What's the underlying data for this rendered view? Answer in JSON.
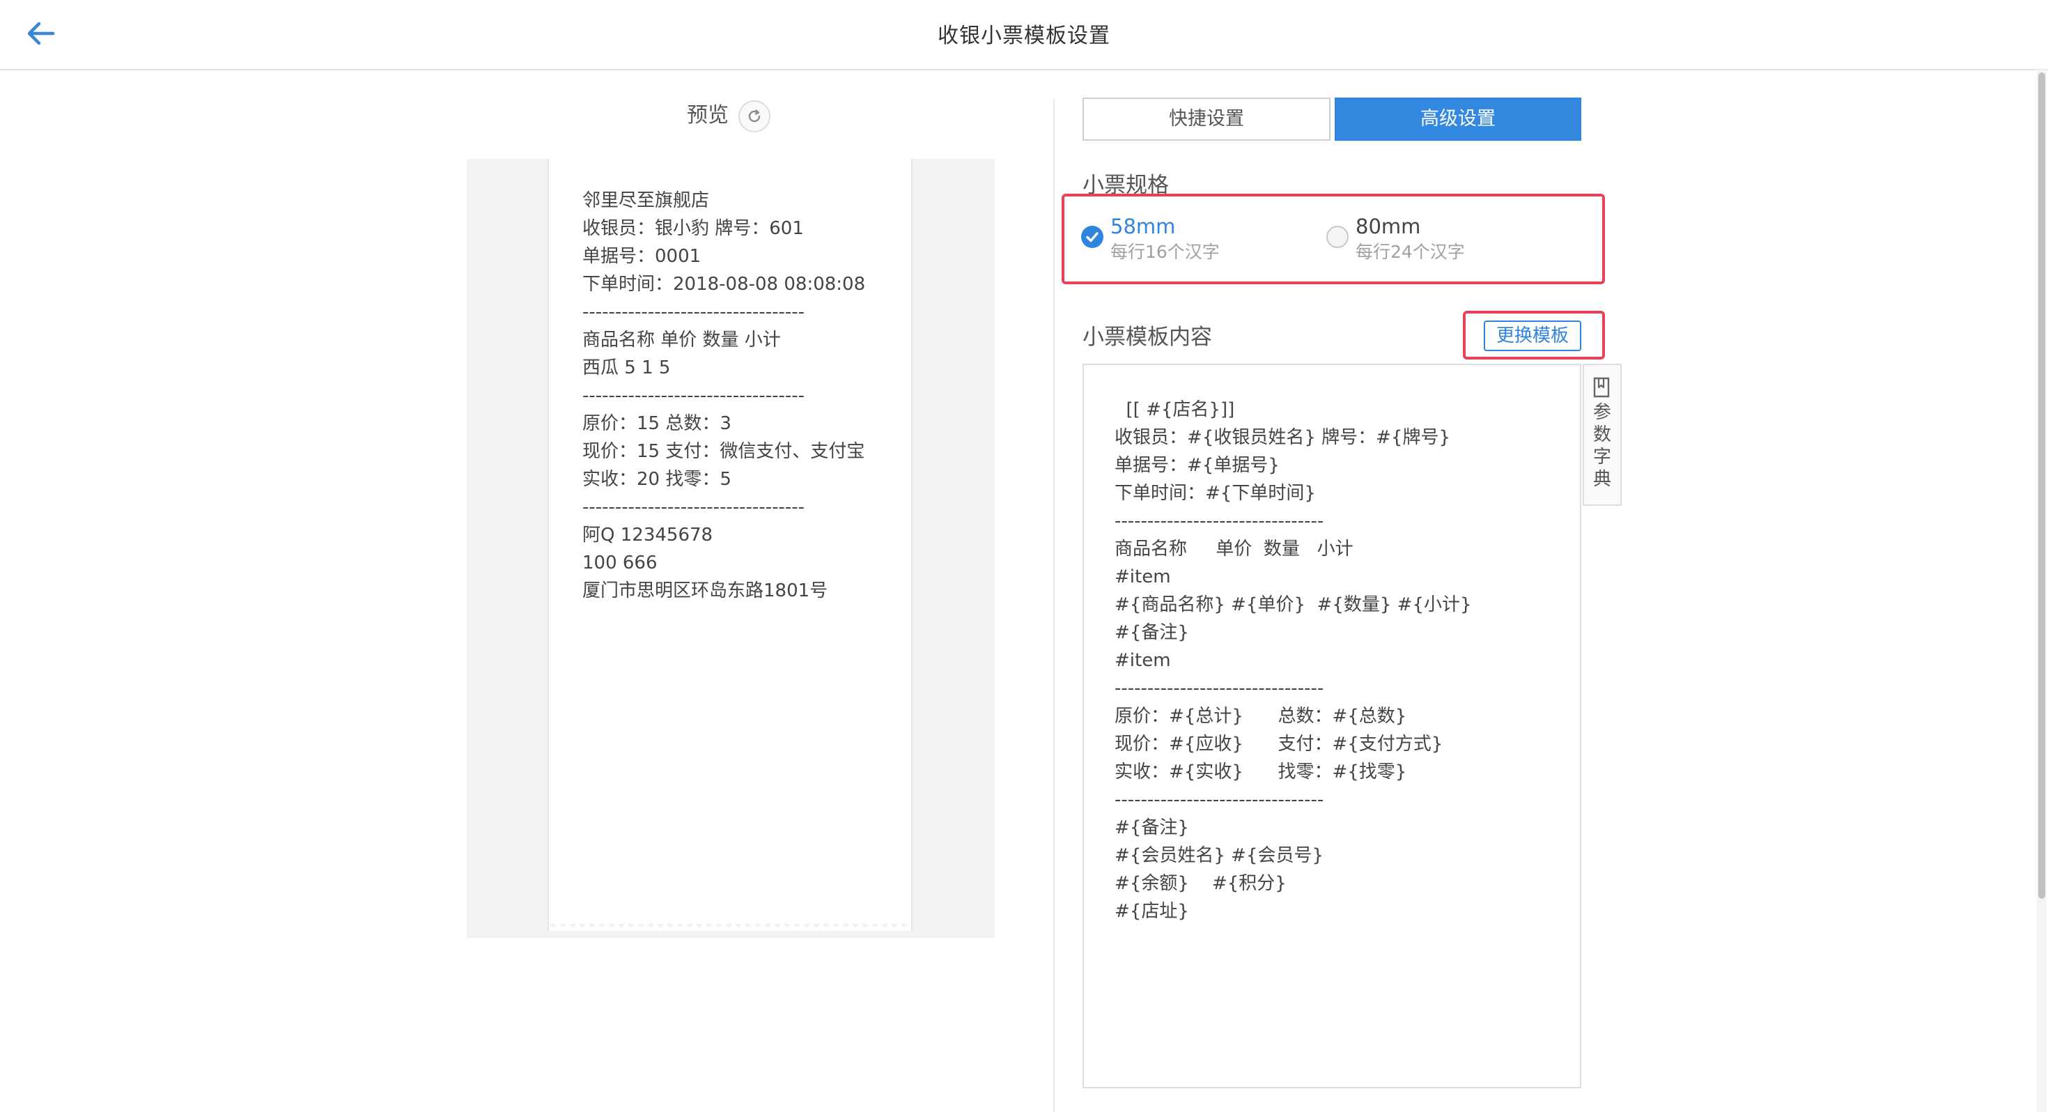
{
  "header": {
    "title": "收银小票模板设置",
    "back_icon": "arrow-left-icon"
  },
  "preview": {
    "label": "预览",
    "refresh_icon": "refresh-icon",
    "receipt_lines": [
      "邻里尽至旗舰店",
      "收银员：银小豹 牌号：601",
      "单据号：0001",
      "下单时间：2018-08-08 08:08:08",
      "----------------------------------",
      "商品名称 单价 数量 小计",
      "西瓜 5 1 5",
      "----------------------------------",
      "原价：15 总数：3",
      "现价：15 支付：微信支付、支付宝",
      "实收：20 找零：5",
      "----------------------------------",
      "阿Q 12345678",
      "100 666",
      "厦门市思明区环岛东路1801号"
    ]
  },
  "tabs": {
    "quick": "快捷设置",
    "advanced": "高级设置",
    "active": "advanced",
    "active_color": "#3388e0"
  },
  "spec": {
    "label": "小票规格",
    "options": [
      {
        "name": "58mm",
        "desc": "每行16个汉字",
        "selected": true
      },
      {
        "name": "80mm",
        "desc": "每行24个汉字",
        "selected": false
      }
    ]
  },
  "template": {
    "label": "小票模板内容",
    "change_button": "更换模板",
    "content_lines": [
      "  [[ #{店名}]]",
      "收银员：#{收银员姓名} 牌号：#{牌号}",
      "单据号：#{单据号}",
      "下单时间：#{下单时间}",
      "--------------------------------",
      "商品名称     单价  数量   小计",
      "#item",
      "#{商品名称} #{单价}  #{数量} #{小计}",
      "#{备注}",
      "#item",
      "--------------------------------",
      "原价：#{总计}      总数：#{总数}",
      "现价：#{应收}      支付：#{支付方式}",
      "实收：#{实收}      找零：#{找零}",
      "--------------------------------",
      "#{备注}",
      "#{会员姓名} #{会员号}",
      "#{余额}    #{积分}",
      "#{店址}"
    ]
  },
  "dictionary": {
    "icon": "book-icon",
    "label_chars": [
      "参",
      "数",
      "字",
      "典"
    ]
  },
  "colors": {
    "accent": "#2f85de",
    "highlight_border": "#e8415a"
  }
}
